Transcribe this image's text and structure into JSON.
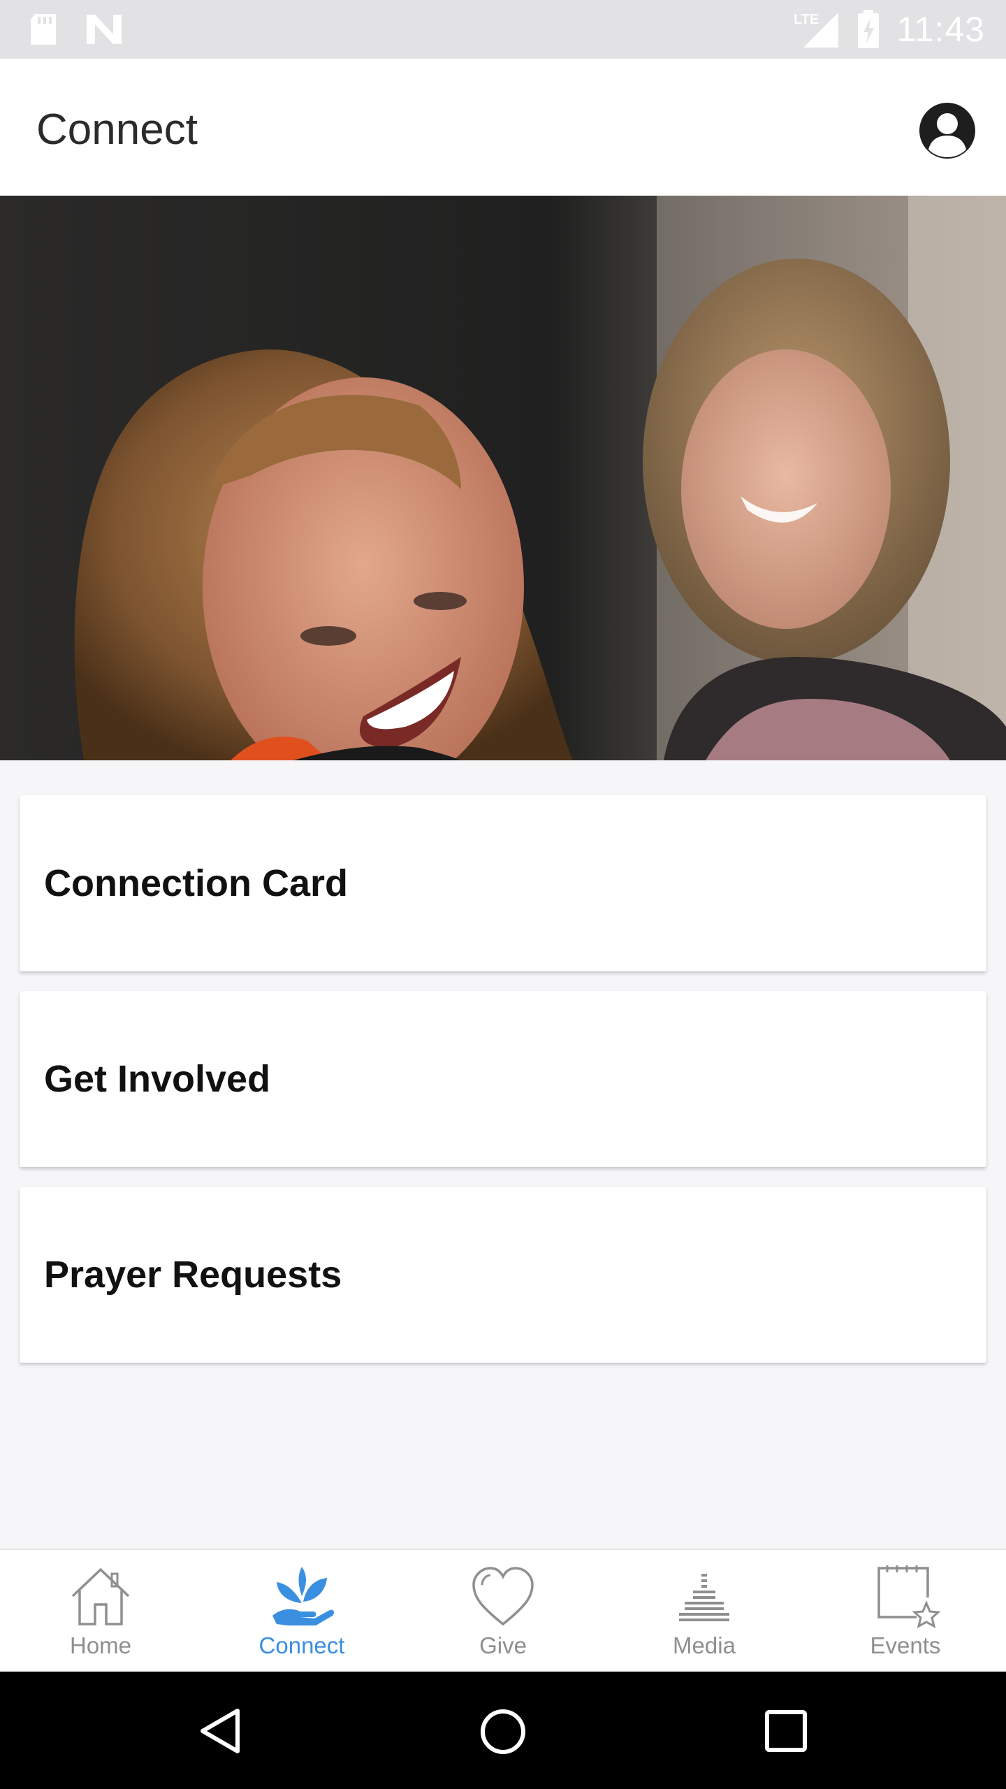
{
  "status_bar": {
    "time": "11:43",
    "network_label": "LTE",
    "icons": [
      "sd-card-icon",
      "n-notification-icon",
      "signal-icon",
      "battery-charging-icon"
    ]
  },
  "app_bar": {
    "title": "Connect",
    "avatar_icon": "account-icon"
  },
  "hero": {
    "description_icon": "hero-photo"
  },
  "cards": [
    {
      "label": "Connection Card"
    },
    {
      "label": "Get Involved"
    },
    {
      "label": "Prayer Requests"
    }
  ],
  "bottom_nav": {
    "items": [
      {
        "label": "Home",
        "icon": "home-icon",
        "active": false
      },
      {
        "label": "Connect",
        "icon": "connect-plant-hand-icon",
        "active": true
      },
      {
        "label": "Give",
        "icon": "heart-icon",
        "active": false
      },
      {
        "label": "Media",
        "icon": "media-bars-icon",
        "active": false
      },
      {
        "label": "Events",
        "icon": "calendar-star-icon",
        "active": false
      }
    ],
    "active_color": "#3b8fe0",
    "inactive_color": "#8f8f8f"
  },
  "system_nav": {
    "icons": [
      "back-icon",
      "home-circle-icon",
      "recents-icon"
    ]
  }
}
